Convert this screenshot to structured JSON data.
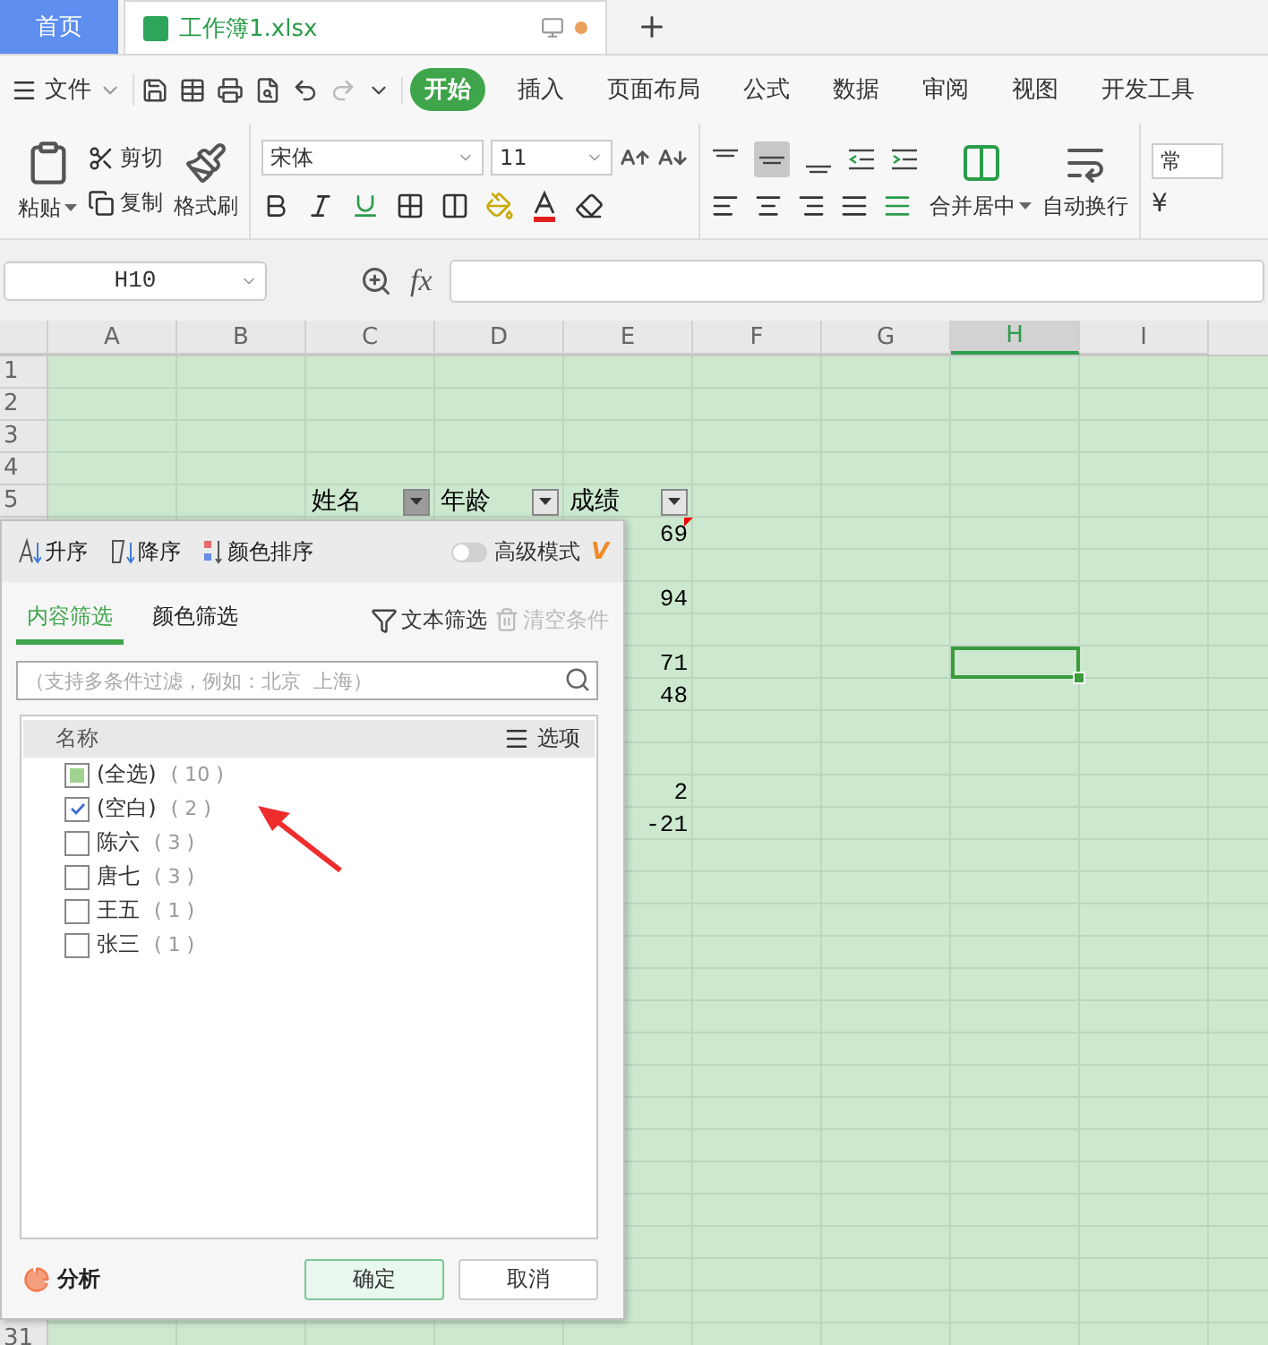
{
  "tabs": [
    {
      "label": "首页",
      "kind": "home",
      "selected": false
    },
    {
      "label": "工作簿1.xlsx",
      "kind": "doc",
      "selected": true,
      "unsaved": true
    }
  ],
  "menu": {
    "file": "文件",
    "ribbon_tabs": [
      {
        "label": "开始",
        "selected": true
      },
      {
        "label": "插入",
        "selected": false
      },
      {
        "label": "页面布局",
        "selected": false
      },
      {
        "label": "公式",
        "selected": false
      },
      {
        "label": "数据",
        "selected": false
      },
      {
        "label": "审阅",
        "selected": false
      },
      {
        "label": "视图",
        "selected": false
      },
      {
        "label": "开发工具",
        "selected": false
      }
    ]
  },
  "ribbon": {
    "paste": "粘贴",
    "cut": "剪切",
    "copy": "复制",
    "format_painter": "格式刷",
    "font": "宋体",
    "size": "11",
    "merge": "合并居中",
    "wrap": "自动换行",
    "number_format": "常",
    "currency": "¥"
  },
  "formula_bar": {
    "name_box": "H10",
    "fx": "fx"
  },
  "sheet": {
    "columns": [
      {
        "label": "A",
        "selected": false
      },
      {
        "label": "B",
        "selected": false
      },
      {
        "label": "C",
        "selected": false
      },
      {
        "label": "D",
        "selected": false
      },
      {
        "label": "E",
        "selected": false
      },
      {
        "label": "F",
        "selected": false
      },
      {
        "label": "G",
        "selected": false
      },
      {
        "label": "H",
        "selected": true
      },
      {
        "label": "I",
        "selected": false
      }
    ],
    "rows": [
      {
        "number": "1"
      },
      {
        "number": "2"
      },
      {
        "number": "3"
      },
      {
        "number": "4"
      },
      {
        "number": "5",
        "cells": {
          "C": {
            "text": "姓名",
            "filter": {
              "selected": true
            }
          },
          "D": {
            "text": "年龄",
            "filter": {
              "selected": false
            }
          },
          "E": {
            "text": "成绩",
            "filter": {
              "selected": false
            }
          }
        }
      },
      {
        "cells": {
          "E": {
            "text": "69",
            "comment": true
          }
        }
      },
      {},
      {
        "cells": {
          "E": {
            "text": "94"
          }
        }
      },
      {},
      {
        "cells": {
          "E": {
            "text": "71"
          },
          "H": {
            "selected": true
          }
        }
      },
      {
        "cells": {
          "E": {
            "text": "48"
          }
        }
      },
      {},
      {},
      {
        "cells": {
          "E": {
            "text": "2"
          }
        }
      },
      {
        "cells": {
          "E": {
            "text": "-21"
          }
        }
      },
      {},
      {},
      {},
      {},
      {},
      {},
      {},
      {},
      {},
      {},
      {},
      {},
      {},
      {},
      {},
      {
        "number": "31"
      }
    ]
  },
  "filter_popup": {
    "sort": [
      {
        "label": "升序",
        "kind": "asc"
      },
      {
        "label": "降序",
        "kind": "desc"
      },
      {
        "label": "颜色排序",
        "kind": "color"
      }
    ],
    "advanced": {
      "label": "高级模式",
      "on": false,
      "badge": "V"
    },
    "tabs": [
      {
        "label": "内容筛选",
        "selected": true
      },
      {
        "label": "颜色筛选",
        "selected": false
      }
    ],
    "text_filter": "文本筛选",
    "clear": {
      "label": "清空条件",
      "disabled": true
    },
    "search": {
      "placeholder": "（支持多条件过滤，例如：北京  上海）"
    },
    "list_header": {
      "name": "名称",
      "options": "选项"
    },
    "items": [
      {
        "label": "(全选)",
        "count": "( 10 )",
        "checked": false,
        "partial": true
      },
      {
        "label": "(空白)",
        "count": "( 2 )",
        "checked": true,
        "partial": false
      },
      {
        "label": "陈六",
        "count": "( 3 )",
        "checked": false,
        "partial": false
      },
      {
        "label": "唐七",
        "count": "( 3 )",
        "checked": false,
        "partial": false
      },
      {
        "label": "王五",
        "count": "( 1 )",
        "checked": false,
        "partial": false
      },
      {
        "label": "张三",
        "count": "( 1 )",
        "checked": false,
        "partial": false
      }
    ],
    "analyze": "分析",
    "buttons": [
      {
        "label": "确定",
        "kind": "primary"
      },
      {
        "label": "取消",
        "kind": "secondary"
      }
    ]
  }
}
